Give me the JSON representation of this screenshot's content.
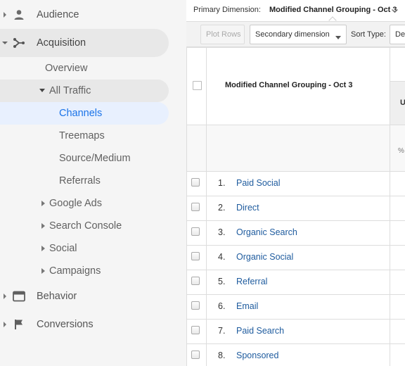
{
  "sidebar": {
    "top_items": [
      {
        "label": "Audience",
        "icon": "person-icon"
      },
      {
        "label": "Acquisition",
        "icon": "acquisition-fork-icon"
      },
      {
        "label": "Behavior",
        "icon": "behavior-window-icon"
      },
      {
        "label": "Conversions",
        "icon": "flag-icon"
      }
    ],
    "acquisition": {
      "overview": "Overview",
      "all_traffic": "All Traffic",
      "all_traffic_children": [
        "Channels",
        "Treemaps",
        "Source/Medium",
        "Referrals"
      ],
      "groups": [
        "Google Ads",
        "Search Console",
        "Social",
        "Campaigns"
      ]
    },
    "selected_item": "Channels"
  },
  "main": {
    "primary_dimension_label": "Primary Dimension:",
    "primary_dimension_value": "Modified Channel Grouping - Oct 3",
    "toolbar": {
      "plot_rows": "Plot Rows",
      "secondary_dimension": "Secondary dimension",
      "sort_type_label": "Sort Type:",
      "sort_type_value": "De"
    },
    "table": {
      "column_header": "Modified Channel Grouping - Oct 3",
      "next_column_header_fragment": "U",
      "summary_fragment": "%",
      "rows": [
        {
          "index": "1.",
          "name": "Paid Social"
        },
        {
          "index": "2.",
          "name": "Direct"
        },
        {
          "index": "3.",
          "name": "Organic Search"
        },
        {
          "index": "4.",
          "name": "Organic Social"
        },
        {
          "index": "5.",
          "name": "Referral"
        },
        {
          "index": "6.",
          "name": "Email"
        },
        {
          "index": "7.",
          "name": "Paid Search"
        },
        {
          "index": "8.",
          "name": "Sponsored"
        }
      ]
    }
  },
  "colors": {
    "sidebar_bg": "#f5f5f5",
    "active_item_bg": "#e8e8e8",
    "selected_item_bg": "#e8f0fe",
    "selected_item_text": "#1a73e8",
    "link_text": "#1e5b9e"
  }
}
